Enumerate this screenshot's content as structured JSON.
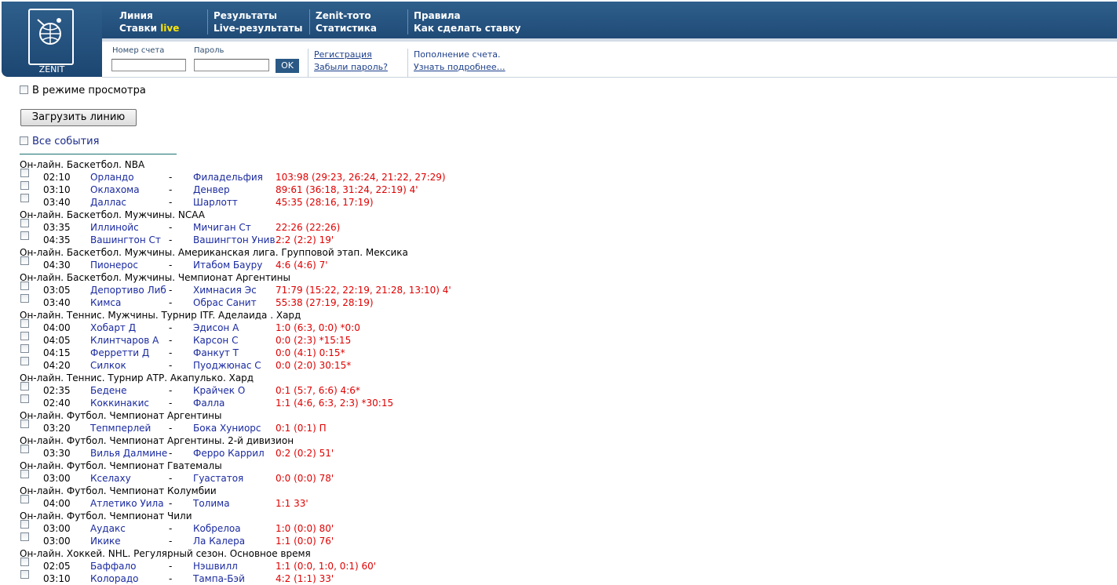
{
  "logo": {
    "text": "ZENIT"
  },
  "nav": [
    {
      "top": "Линия",
      "bottom_prefix": "Ставки ",
      "bottom_live": "live"
    },
    {
      "top": "Результаты",
      "bottom": "Live-результаты"
    },
    {
      "top": "Zenit-тото",
      "bottom": "Статистика"
    },
    {
      "top": "Правила",
      "bottom": "Как сделать ставку"
    }
  ],
  "login": {
    "account_label": "Номер счета",
    "password_label": "Пароль",
    "ok_label": "OK",
    "register_link": "Регистрация",
    "forgot_link": "Забыли пароль?",
    "topup_text": "Пополнение счета.",
    "more_link": "Узнать подробнее…"
  },
  "main": {
    "view_mode_label": "В режиме просмотра",
    "load_button": "Загрузить линию",
    "all_events_label": "Все события"
  },
  "leagues": [
    {
      "name": "Он-лайн. Баскетбол. NBA",
      "events": [
        {
          "time": "02:10",
          "team1": "Орландо",
          "team2": "Филадельфия",
          "score": "103:98 (29:23, 26:24, 21:22, 27:29)"
        },
        {
          "time": "03:10",
          "team1": "Оклахома",
          "team2": "Денвер",
          "score": "89:61 (36:18, 31:24, 22:19) 4'"
        },
        {
          "time": "03:40",
          "team1": "Даллас",
          "team2": "Шарлотт",
          "score": "45:35 (28:16, 17:19)"
        }
      ]
    },
    {
      "name": "Он-лайн. Баскетбол. Мужчины. NCAA",
      "events": [
        {
          "time": "03:35",
          "team1": "Иллинойс",
          "team2": "Мичиган Ст",
          "score": "22:26 (22:26)"
        },
        {
          "time": "04:35",
          "team1": "Вашингтон Ст",
          "team2": "Вашингтон Унив",
          "score": "2:2 (2:2) 19'"
        }
      ]
    },
    {
      "name": "Он-лайн. Баскетбол. Мужчины. Американская лига. Групповой этап. Мексика",
      "events": [
        {
          "time": "04:30",
          "team1": "Пионерос",
          "team2": "Итабом Бауру",
          "score": "4:6 (4:6) 7'"
        }
      ]
    },
    {
      "name": "Он-лайн. Баскетбол. Мужчины. Чемпионат Аргентины",
      "events": [
        {
          "time": "03:05",
          "team1": "Депортиво Либ",
          "team2": "Химнасия Эс",
          "score": "71:79 (15:22, 22:19, 21:28, 13:10) 4'"
        },
        {
          "time": "03:40",
          "team1": "Кимса",
          "team2": "Обрас Санит",
          "score": "55:38 (27:19, 28:19)"
        }
      ]
    },
    {
      "name": "Он-лайн. Теннис. Мужчины. Турнир ITF. Аделаида . Хард",
      "events": [
        {
          "time": "04:00",
          "team1": "Хобарт Д",
          "team2": "Эдисон А",
          "score": "1:0 (6:3, 0:0) *0:0"
        },
        {
          "time": "04:05",
          "team1": "Клинтчаров А",
          "team2": "Карсон С",
          "score": "0:0 (2:3) *15:15"
        },
        {
          "time": "04:15",
          "team1": "Ферретти Д",
          "team2": "Фанкут Т",
          "score": "0:0 (4:1) 0:15*"
        },
        {
          "time": "04:20",
          "team1": "Силкок",
          "team2": "Пуоджюнас С",
          "score": "0:0 (2:0) 30:15*"
        }
      ]
    },
    {
      "name": "Он-лайн. Теннис. Турнир АТР. Акапулько. Хард",
      "events": [
        {
          "time": "02:35",
          "team1": "Бедене",
          "team2": "Крайчек О",
          "score": "0:1 (5:7, 6:6) 4:6*"
        },
        {
          "time": "02:40",
          "team1": "Коккинакис",
          "team2": "Фалла",
          "score": "1:1 (4:6, 6:3, 2:3) *30:15"
        }
      ]
    },
    {
      "name": "Он-лайн. Футбол. Чемпионат Аргентины",
      "events": [
        {
          "time": "03:20",
          "team1": "Тепмперлей",
          "team2": "Бока Хуниорс",
          "score": "0:1 (0:1) П"
        }
      ]
    },
    {
      "name": "Он-лайн. Футбол. Чемпионат Аргентины. 2-й дивизион",
      "events": [
        {
          "time": "03:30",
          "team1": "Вилья Далмине",
          "team2": "Ферро Каррил",
          "score": "0:2 (0:2) 51'"
        }
      ]
    },
    {
      "name": "Он-лайн. Футбол. Чемпионат Гватемалы",
      "events": [
        {
          "time": "03:00",
          "team1": "Кселаху",
          "team2": "Гуастатоя",
          "score": "0:0 (0:0) 78'"
        }
      ]
    },
    {
      "name": "Он-лайн. Футбол. Чемпионат Колумбии",
      "events": [
        {
          "time": "04:00",
          "team1": "Атлетико Уила",
          "team2": "Толима",
          "score": "1:1 33'"
        }
      ]
    },
    {
      "name": "Он-лайн. Футбол. Чемпионат Чили",
      "events": [
        {
          "time": "03:00",
          "team1": "Аудакс",
          "team2": "Кобрелоа",
          "score": "1:0 (0:0) 80'"
        },
        {
          "time": "03:00",
          "team1": "Икике",
          "team2": "Ла Калера",
          "score": "1:1 (0:0) 76'"
        }
      ]
    },
    {
      "name": "Он-лайн. Хоккей. NHL. Регулярный сезон. Основное время",
      "events": [
        {
          "time": "02:05",
          "team1": "Баффало",
          "team2": "Нэшвилл",
          "score": "1:1 (0:0, 1:0, 0:1) 60'"
        },
        {
          "time": "03:10",
          "team1": "Колорадо",
          "team2": "Тампа-Бэй",
          "score": "4:2 (1:1) 33'"
        }
      ]
    }
  ]
}
